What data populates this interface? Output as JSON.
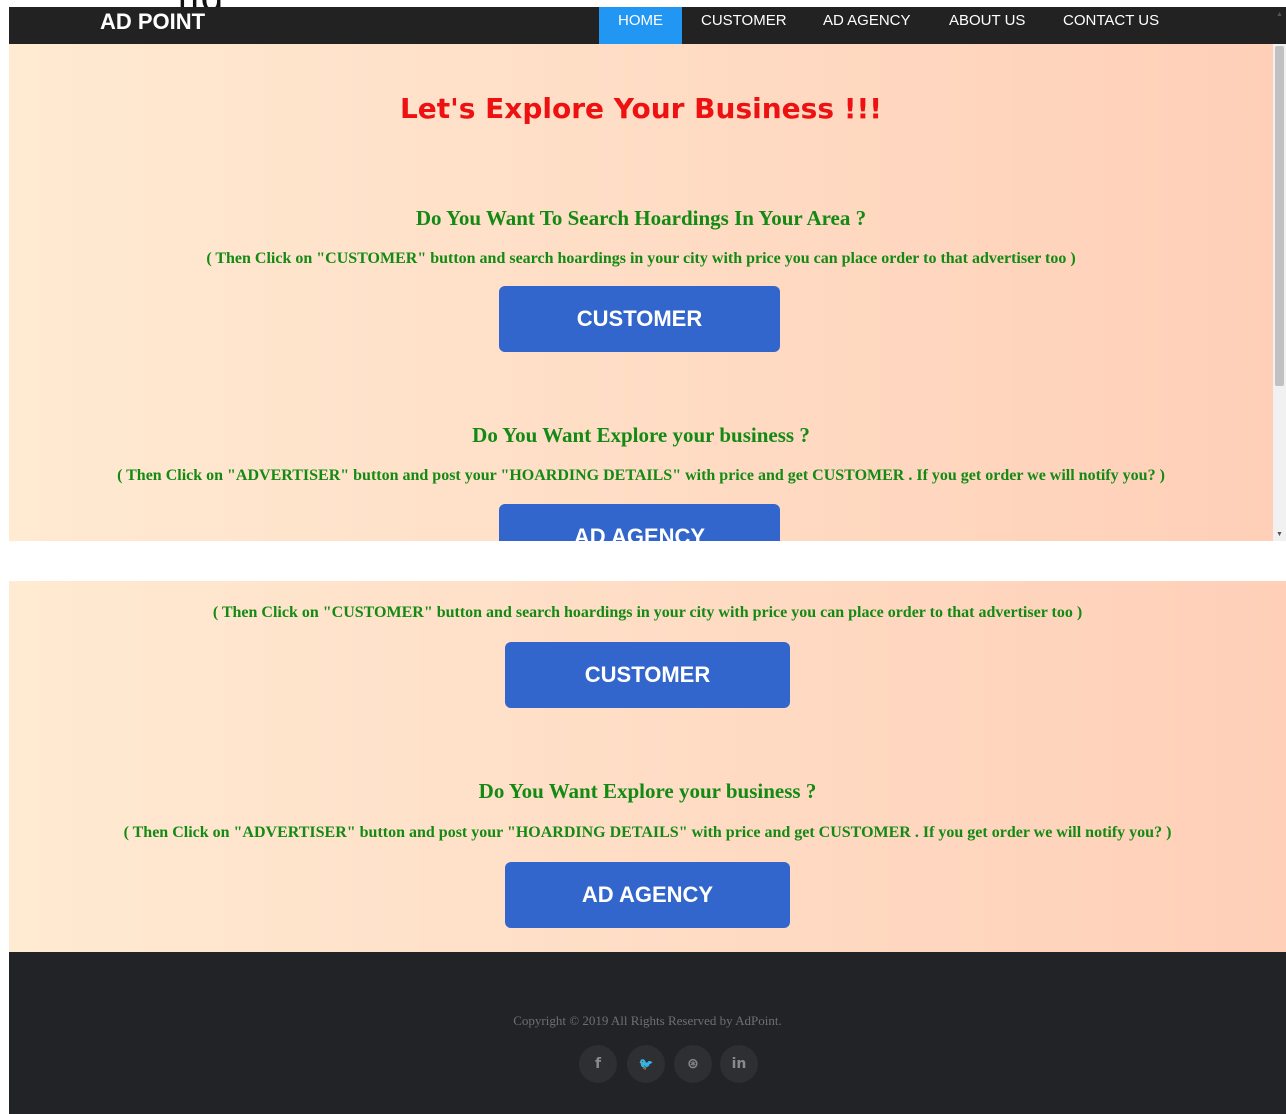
{
  "top_stray_text": "ng",
  "navbar": {
    "brand": "AD POINT",
    "items": [
      {
        "label": "HOME",
        "active": true
      },
      {
        "label": "CUSTOMER",
        "active": false
      },
      {
        "label": "AD AGENCY",
        "active": false
      },
      {
        "label": "ABOUT US",
        "active": false
      },
      {
        "label": "CONTACT US",
        "active": false
      }
    ]
  },
  "hero": {
    "headline": "Let's Explore Your Business !!!",
    "customer_section": {
      "title": "Do You Want To Search Hoardings In Your Area ?",
      "desc": "( Then Click on \"CUSTOMER\" button and search hoardings in your city with price you can place order to that advertiser too )",
      "button": "CUSTOMER"
    },
    "advertiser_section": {
      "title": "Do You Want Explore your business ?",
      "desc": "( Then Click on \"ADVERTISER\" button and post your \"HOARDING DETAILS\" with price and get CUSTOMER . If you get order we will notify you? )",
      "button": "AD AGENCY"
    }
  },
  "footer": {
    "copyright": "Copyright © 2019 All Rights Reserved by AdPoint.",
    "social": [
      {
        "icon": "facebook-icon",
        "glyph": "f"
      },
      {
        "icon": "twitter-icon",
        "glyph": "🐦"
      },
      {
        "icon": "dribbble-icon",
        "glyph": "⊛"
      },
      {
        "icon": "linkedin-icon",
        "glyph": "in"
      }
    ]
  },
  "colors": {
    "nav_bg": "#222222",
    "nav_active": "#2196f3",
    "headline": "#ee1111",
    "section_text": "#138a13",
    "button": "#3366cc",
    "footer_bg": "#222326"
  }
}
